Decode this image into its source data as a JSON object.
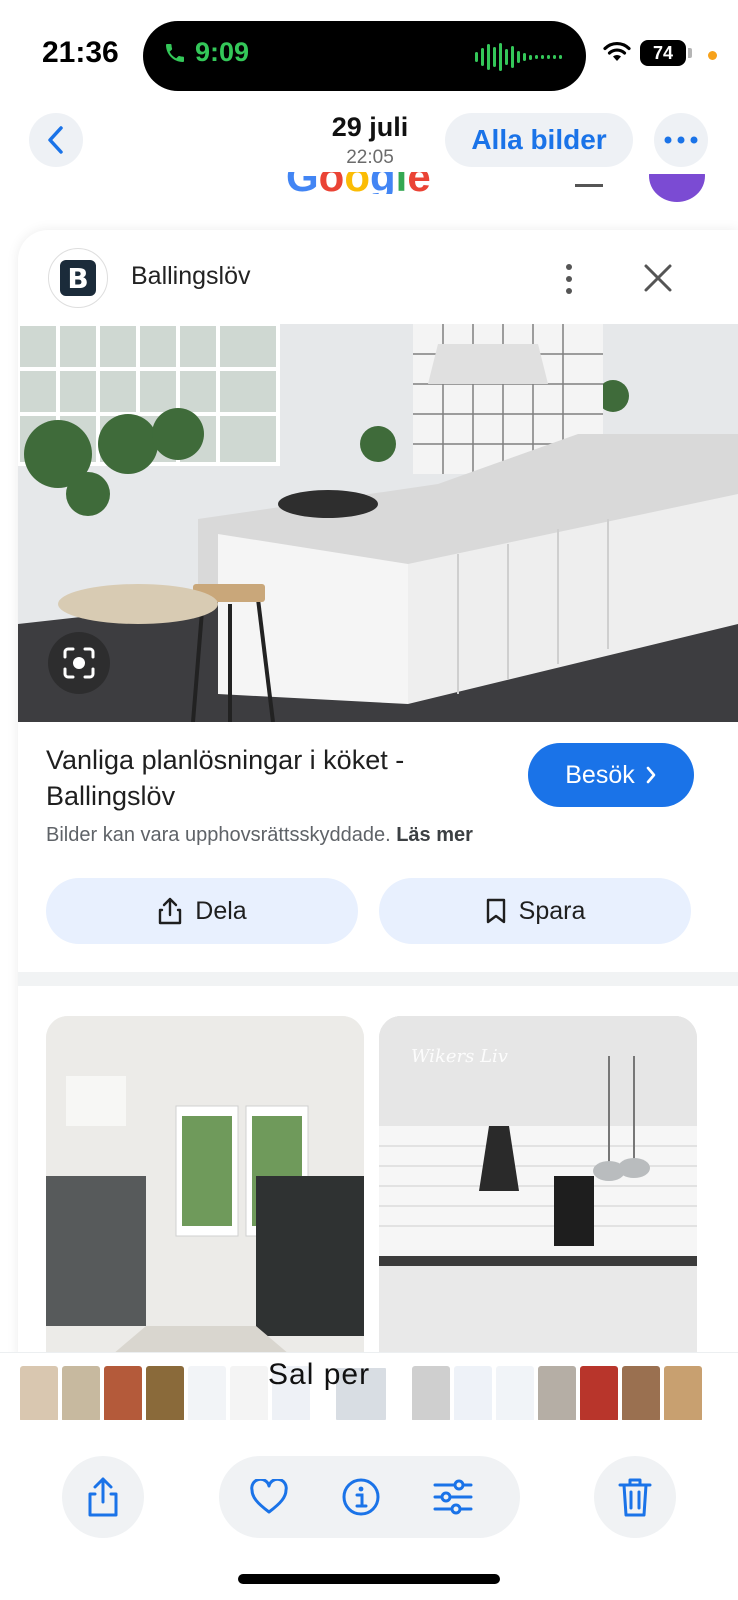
{
  "status_bar": {
    "time": "21:36",
    "call_timer": "9:09",
    "battery": "74"
  },
  "nav": {
    "date": "29 juli",
    "time": "22:05",
    "all_photos_label": "Alla bilder"
  },
  "background_page": {
    "google_letters": [
      "G",
      "o",
      "o",
      "g",
      "l",
      "e"
    ],
    "google_colors": [
      "#4285f4",
      "#ea4335",
      "#fbbc05",
      "#4285f4",
      "#34a853",
      "#ea4335"
    ]
  },
  "card": {
    "site_name": "Ballingslöv",
    "site_logo_letter": "B",
    "result_title": "Vanliga planlösningar i köket - Ballingslöv",
    "visit_label": "Besök",
    "copyright_text": "Bilder kan vara upphovsrättsskyddade.",
    "learn_more_label": "Läs mer",
    "share_label": "Dela",
    "save_label": "Spara",
    "thumb2_caption": "Wikers Liv"
  },
  "filmstrip": {
    "ghost_text": "Sal  per"
  },
  "colors": {
    "accent": "#1a73e8",
    "call_green": "#34c759",
    "pill_bg": "#e8f0fe"
  }
}
